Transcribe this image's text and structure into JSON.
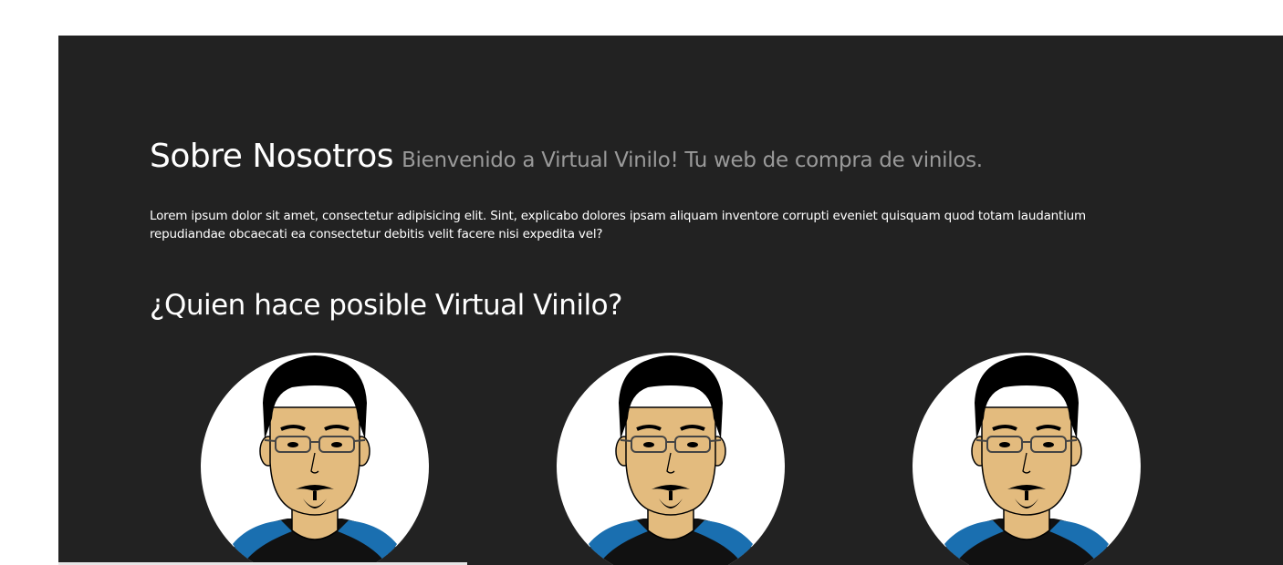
{
  "about": {
    "title": "Sobre Nosotros",
    "subtitle": "Bienvenido a Virtual Vinilo! Tu web de compra de vinilos.",
    "paragraph": "Lorem ipsum dolor sit amet, consectetur adipisicing elit. Sint, explicabo dolores ipsam aliquam inventore corrupti eveniet quisquam quod totam laudantium repudiandae obcaecati ea consectetur debitis velit facere nisi expedita vel?"
  },
  "team": {
    "heading": "¿Quien hace posible Virtual Vinilo?",
    "members": [
      {
        "avatar_icon": "person-avatar-icon"
      },
      {
        "avatar_icon": "person-avatar-icon"
      },
      {
        "avatar_icon": "person-avatar-icon"
      }
    ]
  },
  "colors": {
    "panel_background": "#222222",
    "subtitle_gray": "#9a9a9a",
    "skin": "#e3bb7e",
    "shirt_blue": "#1a6fb0"
  }
}
